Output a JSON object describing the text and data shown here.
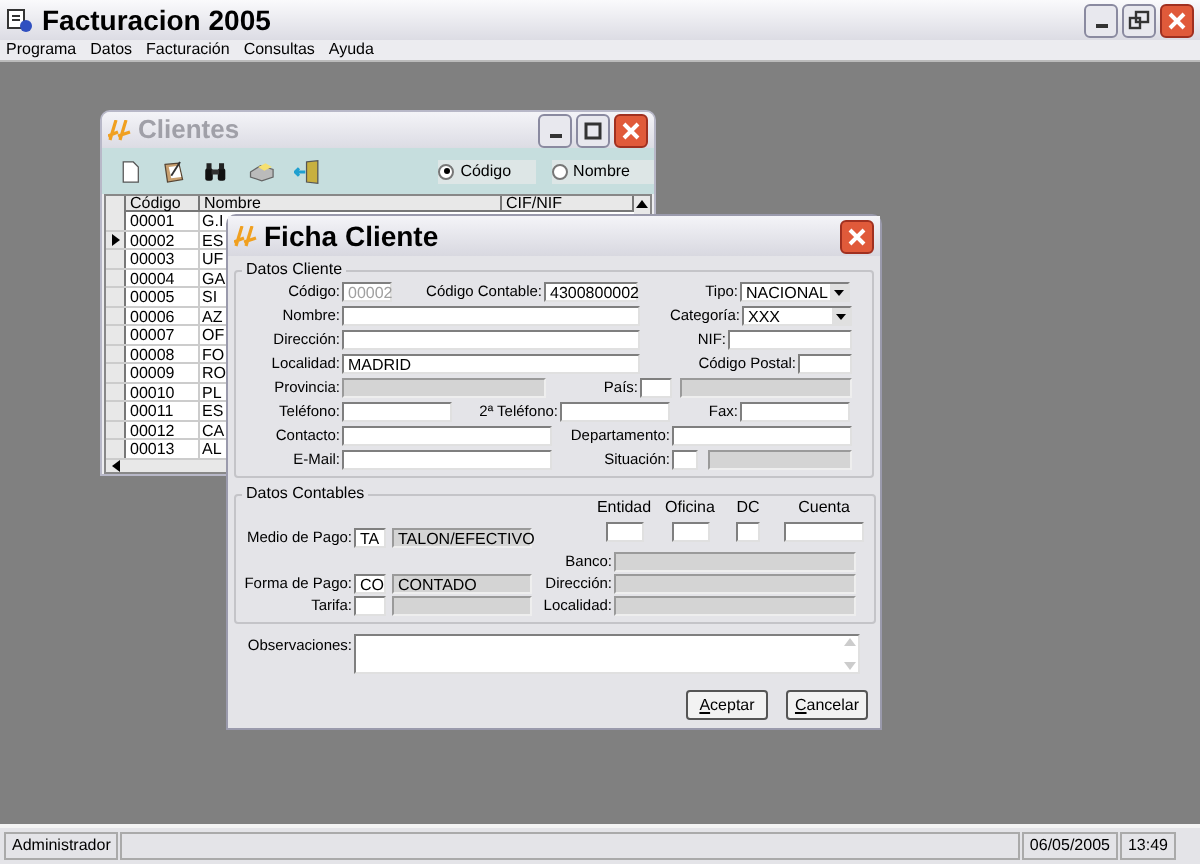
{
  "window": {
    "title": "Facturacion 2005"
  },
  "menu": [
    "Programa",
    "Datos",
    "Facturación",
    "Consultas",
    "Ayuda"
  ],
  "clientes": {
    "title": "Clientes",
    "radios": [
      {
        "label": "Código",
        "selected": true
      },
      {
        "label": "Nombre",
        "selected": false
      }
    ],
    "columns": [
      "Código",
      "Nombre",
      "CIF/NIF"
    ],
    "rows": [
      {
        "code": "00001",
        "name": "G.I",
        "selected": false
      },
      {
        "code": "00002",
        "name": "ES",
        "selected": true
      },
      {
        "code": "00003",
        "name": "UF",
        "selected": false
      },
      {
        "code": "00004",
        "name": "GA",
        "selected": false
      },
      {
        "code": "00005",
        "name": "SI",
        "selected": false
      },
      {
        "code": "00006",
        "name": "AZ",
        "selected": false
      },
      {
        "code": "00007",
        "name": "OF",
        "selected": false
      },
      {
        "code": "00008",
        "name": "FO",
        "selected": false
      },
      {
        "code": "00009",
        "name": "RO",
        "selected": false
      },
      {
        "code": "00010",
        "name": "PL",
        "selected": false
      },
      {
        "code": "00011",
        "name": "ES",
        "selected": false
      },
      {
        "code": "00012",
        "name": "CA",
        "selected": false
      },
      {
        "code": "00013",
        "name": "AL",
        "selected": false
      }
    ]
  },
  "ficha": {
    "title": "Ficha Cliente",
    "datos_cliente": {
      "title": "Datos Cliente",
      "rows": [
        [
          {
            "label": "Código:",
            "value": "00002",
            "kind": "disabled"
          },
          {
            "label": "Código Contable:",
            "value": "4300800002",
            "kind": "number"
          },
          {
            "label": "Tipo:",
            "value": "NACIONAL",
            "kind": "select"
          }
        ],
        [
          {
            "label": "Nombre:",
            "kind": "text"
          },
          {
            "label": "Categoría:",
            "value": "XXX",
            "kind": "select"
          }
        ],
        [
          {
            "label": "Dirección:",
            "kind": "text"
          },
          {
            "label": "NIF:",
            "kind": "text"
          }
        ],
        [
          {
            "label": "Localidad:",
            "value": "MADRID",
            "kind": "text"
          },
          {
            "label": "Código Postal:",
            "kind": "text"
          }
        ],
        [
          {
            "label": "Provincia:",
            "kind": "readonly"
          },
          {
            "label": "País:",
            "kind": "text"
          },
          {
            "kind": "readonly"
          }
        ],
        [
          {
            "label": "Teléfono:",
            "kind": "text"
          },
          {
            "label": "2ª Teléfono:",
            "kind": "text"
          },
          {
            "label": "Fax:",
            "kind": "text"
          }
        ],
        [
          {
            "label": "Contacto:",
            "kind": "text"
          },
          {
            "label": "Departamento:",
            "kind": "text"
          }
        ],
        [
          {
            "label": "E-Mail:",
            "kind": "text"
          },
          {
            "label": "Situación:",
            "kind": "text"
          },
          {
            "kind": "readonly"
          }
        ]
      ]
    },
    "datos_contables": {
      "title": "Datos Contables",
      "bank_headers": [
        "Entidad",
        "Oficina",
        "DC",
        "Cuenta"
      ],
      "left_rows": [
        {
          "label": "Medio de Pago:",
          "code": "TA",
          "description": "TALON/EFECTIVO"
        },
        {
          "label": "Forma de Pago:",
          "code": "CO",
          "description": "CONTADO"
        },
        {
          "label": "Tarifa:"
        }
      ],
      "right_rows": [
        {
          "label": "Banco:"
        },
        {
          "label": "Dirección:"
        },
        {
          "label": "Localidad:"
        }
      ]
    },
    "observaciones": {
      "label": "Observaciones:"
    },
    "buttons": [
      "Aceptar",
      "Cancelar"
    ]
  },
  "status_bar": {
    "user": "Administrador",
    "date": "06/05/2005",
    "time": "13:49"
  }
}
